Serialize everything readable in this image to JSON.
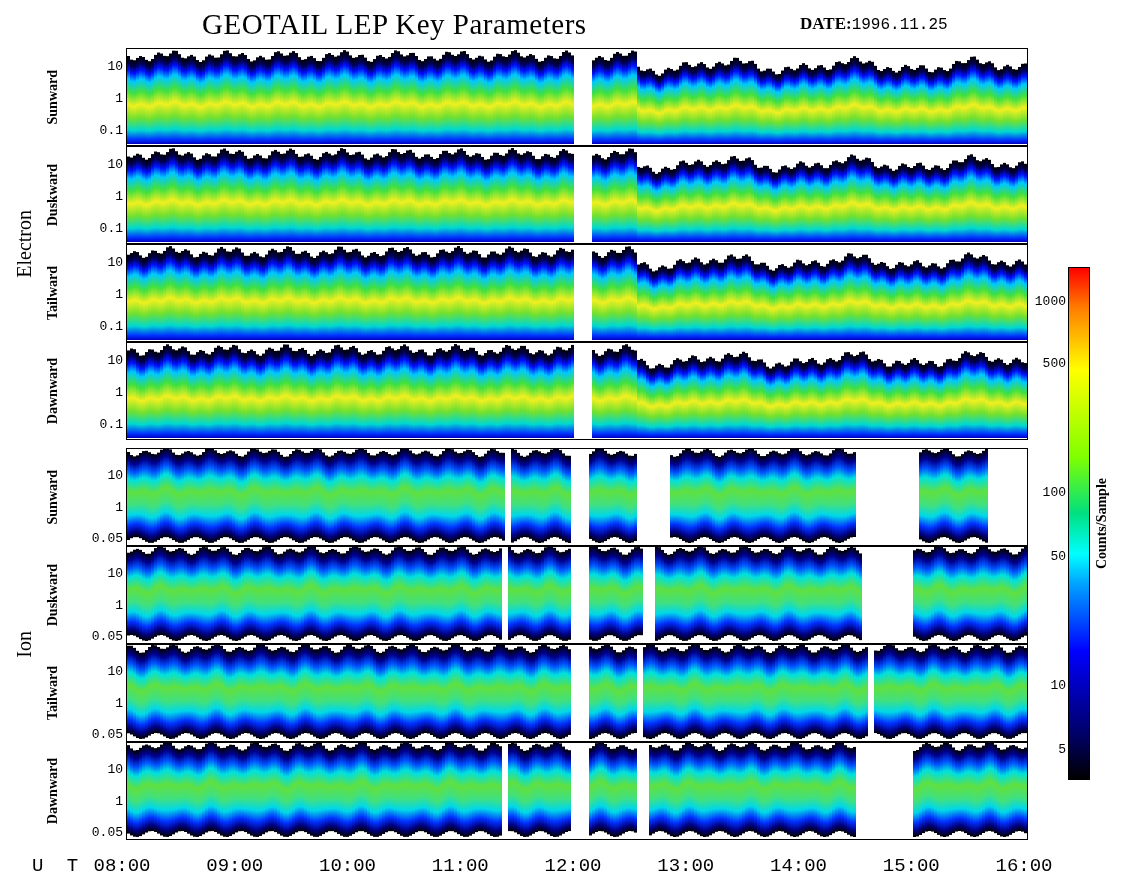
{
  "title": "GEOTAIL LEP Key Parameters",
  "date": {
    "label": "DATE:",
    "value": "1996.11.25"
  },
  "groups": [
    {
      "kind": "electron",
      "label": "Electron",
      "panels": [
        {
          "label": "Sunward",
          "yticks": [
            "10",
            "1",
            "0.1"
          ]
        },
        {
          "label": "Duskward",
          "yticks": [
            "10",
            "1",
            "0.1"
          ]
        },
        {
          "label": "Tailward",
          "yticks": [
            "10",
            "1",
            "0.1"
          ]
        },
        {
          "label": "Dawnward",
          "yticks": [
            "10",
            "1",
            "0.1"
          ]
        }
      ]
    },
    {
      "kind": "ion",
      "label": "Ion",
      "panels": [
        {
          "label": "Sunward",
          "yticks": [
            "10",
            "1",
            "0.05"
          ]
        },
        {
          "label": "Duskward",
          "yticks": [
            "10",
            "1",
            "0.05"
          ]
        },
        {
          "label": "Tailward",
          "yticks": [
            "10",
            "1",
            "0.05"
          ]
        },
        {
          "label": "Dawnward",
          "yticks": [
            "10",
            "1",
            "0.05"
          ]
        }
      ]
    }
  ],
  "time_axis": {
    "label": "U T",
    "ticks": [
      "08:00",
      "09:00",
      "10:00",
      "11:00",
      "12:00",
      "13:00",
      "14:00",
      "15:00",
      "16:00"
    ]
  },
  "colorbar": {
    "label": "Counts/Sample",
    "ticks": [
      "1000",
      "500",
      "100",
      "50",
      "10",
      "5"
    ]
  }
}
